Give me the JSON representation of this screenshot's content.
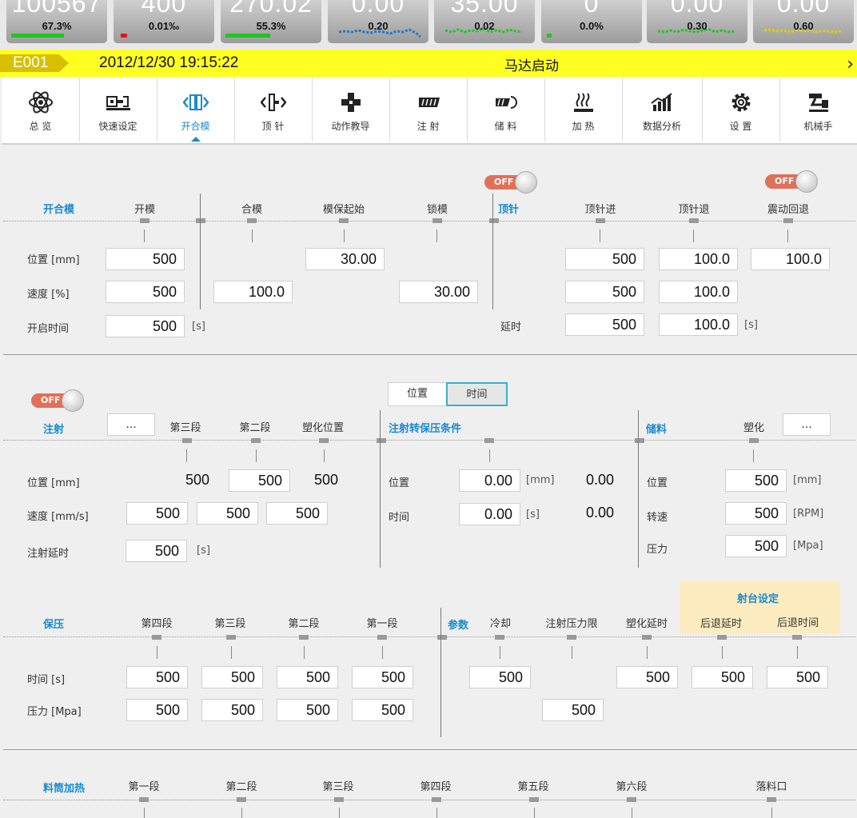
{
  "stats": [
    {
      "big": "100567",
      "small": "67.3%",
      "indicator": "bar",
      "fill": 0.5
    },
    {
      "big": "400",
      "small": "0.01‰",
      "indicator": "red"
    },
    {
      "big": "270.02",
      "small": "55.3%",
      "indicator": "bar",
      "fill": 0.5
    },
    {
      "big": "0.00",
      "small": "0.20",
      "indicator": "spark",
      "color": "#1a7acc"
    },
    {
      "big": "35.00",
      "small": "0.02",
      "indicator": "spark",
      "color": "#22c422"
    },
    {
      "big": "0",
      "small": "0.0%",
      "indicator": "dot"
    },
    {
      "big": "0.00",
      "small": "0.30",
      "indicator": "spark",
      "color": "#22c422"
    },
    {
      "big": "0.00",
      "small": "0.60",
      "indicator": "spark",
      "color": "#e0d000"
    }
  ],
  "alarm": {
    "code": "E001",
    "time": "2012/12/30 19:15:22",
    "message": "马达启动",
    "next": "›"
  },
  "nav": [
    {
      "label": "总 览",
      "icon": "atom-icon"
    },
    {
      "label": "快速设定",
      "icon": "machine-icon"
    },
    {
      "label": "开合模",
      "icon": "mold-icon",
      "active": true
    },
    {
      "label": "顶 针",
      "icon": "ejector-icon"
    },
    {
      "label": "动作教导",
      "icon": "teach-icon"
    },
    {
      "label": "注 射",
      "icon": "injection-icon"
    },
    {
      "label": "储 料",
      "icon": "charge-icon"
    },
    {
      "label": "加 热",
      "icon": "heat-icon"
    },
    {
      "label": "数据分析",
      "icon": "chart-icon"
    },
    {
      "label": "设 置",
      "icon": "gear-icon"
    },
    {
      "label": "机械手",
      "icon": "robot-icon"
    }
  ],
  "mold": {
    "title": "开合模",
    "toggle": "OFF",
    "headers": {
      "open": "开模",
      "close": "合模",
      "protect": "模保起始",
      "lock": "锁模"
    },
    "rows": {
      "pos": "位置 [mm]",
      "speed": "速度 [%]",
      "open_time": "开启时间"
    },
    "unit_s": "[s]",
    "values": {
      "open_pos": "500",
      "open_speed": "500",
      "open_time": "500",
      "close_speed": "100.0",
      "protect_pos": "30.00",
      "lock_speed": "30.00"
    }
  },
  "ejector": {
    "title": "顶针",
    "toggle": "OFF",
    "headers": {
      "fwd": "顶针进",
      "back": "顶针退",
      "vib": "震动回退"
    },
    "delay_label": "延时",
    "unit_s": "[s]",
    "values": {
      "fwd_pos": "500",
      "back_pos": "100.0",
      "vib_pos": "100.0",
      "fwd_speed": "500",
      "back_speed": "100.0",
      "fwd_delay": "500",
      "back_delay": "100.0"
    }
  },
  "injection": {
    "title": "注射",
    "toggle": "OFF",
    "dots": "...",
    "headers": {
      "s3": "第三段",
      "s2": "第二段",
      "plast": "塑化位置"
    },
    "rows": {
      "pos": "位置 [mm]",
      "speed": "速度 [mm/s]",
      "delay": "注射延时"
    },
    "unit_s": "[s]",
    "values": {
      "pos_s3": "500",
      "pos_s2": "500",
      "pos_plast": "500",
      "speed_1": "500",
      "speed_2": "500",
      "speed_3": "500",
      "delay": "500"
    }
  },
  "switch": {
    "tab_pos": "位置",
    "tab_time": "时间",
    "title": "注射转保压条件",
    "pos_label": "位置",
    "time_label": "时间",
    "pos_value": "0.00",
    "pos_unit": "[mm]",
    "pos_actual": "0.00",
    "time_value": "0.00",
    "time_unit": "[s]",
    "time_actual": "0.00"
  },
  "charge": {
    "title": "储料",
    "header": "塑化",
    "dots": "...",
    "rows": {
      "pos": "位置",
      "rpm": "转速",
      "pressure": "压力"
    },
    "values": {
      "pos": "500",
      "rpm": "500",
      "pressure": "500"
    },
    "units": {
      "pos": "[mm]",
      "rpm": "[RPM]",
      "pressure": "[Mpa]"
    }
  },
  "hold": {
    "title": "保压",
    "headers": {
      "s4": "第四段",
      "s3": "第三段",
      "s2": "第二段",
      "s1": "第一段"
    },
    "rows": {
      "time": "时间 [s]",
      "pressure": "压力 [Mpa]"
    },
    "time": [
      "500",
      "500",
      "500",
      "500"
    ],
    "pressure": [
      "500",
      "500",
      "500",
      "500"
    ]
  },
  "params": {
    "title": "参数",
    "headers": {
      "cool": "冷却",
      "limit": "注射压力限",
      "plast_delay": "塑化延时"
    },
    "values": {
      "cool": "500",
      "plast_delay": "500",
      "limit": "500"
    }
  },
  "jet": {
    "title": "射台设定",
    "headers": {
      "retreat_delay": "后退延时",
      "retreat_time": "后退时间"
    },
    "values": {
      "retreat_delay": "500",
      "retreat_time": "500"
    }
  },
  "barrel": {
    "title": "料筒加热",
    "headers": [
      "第一段",
      "第二段",
      "第三段",
      "第四段",
      "第五段",
      "第六段",
      "落料口"
    ]
  }
}
